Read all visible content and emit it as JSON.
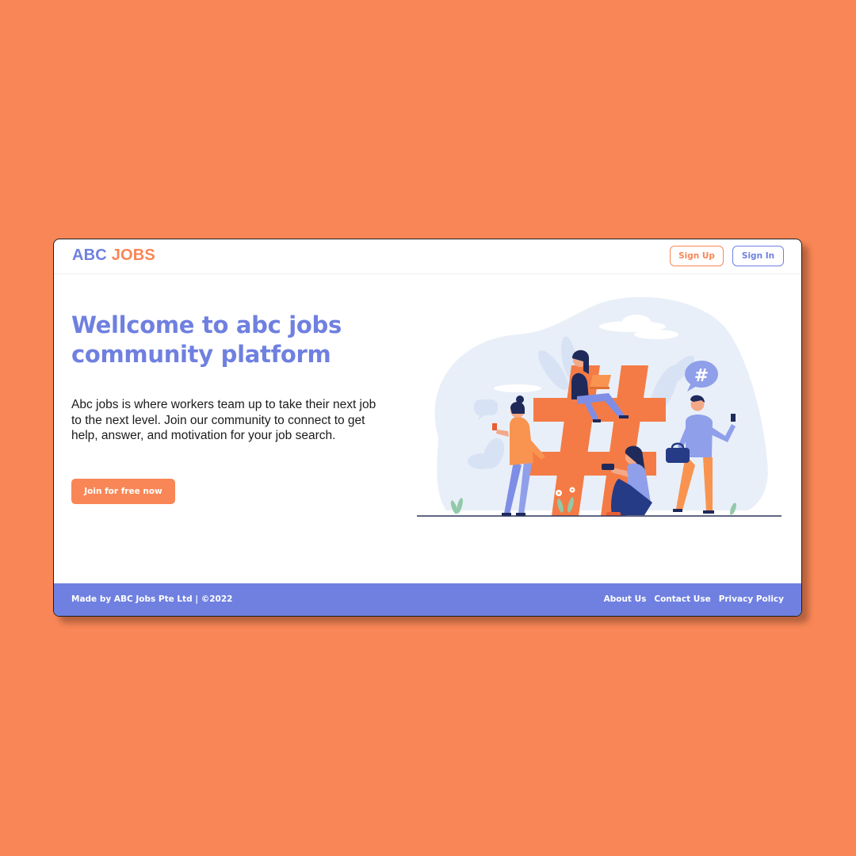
{
  "header": {
    "logo_part1": "ABC",
    "logo_part2": "JOBS",
    "signup_label": "Sign Up",
    "signin_label": "Sign In"
  },
  "hero": {
    "title_line1": "Wellcome to abc jobs",
    "title_line2": "community platform",
    "desc_line1": "Abc jobs is where workers team up to take their next job",
    "desc_line2": "to the next level. Join our community to connect to get",
    "desc_line3": "help, answer, and motivation for your job search.",
    "cta_label": "Join for free now",
    "illustration_icon": "hashtag-community-illustration",
    "speech_bubble_symbol": "#"
  },
  "footer": {
    "copyright": "Made by ABC Jobs Pte Ltd | ©2022",
    "links": [
      "About Us",
      "Contact Use",
      "Privacy Policy"
    ]
  },
  "colors": {
    "background": "#F98656",
    "accent_blue": "#6F80E0",
    "accent_orange": "#F98656"
  }
}
